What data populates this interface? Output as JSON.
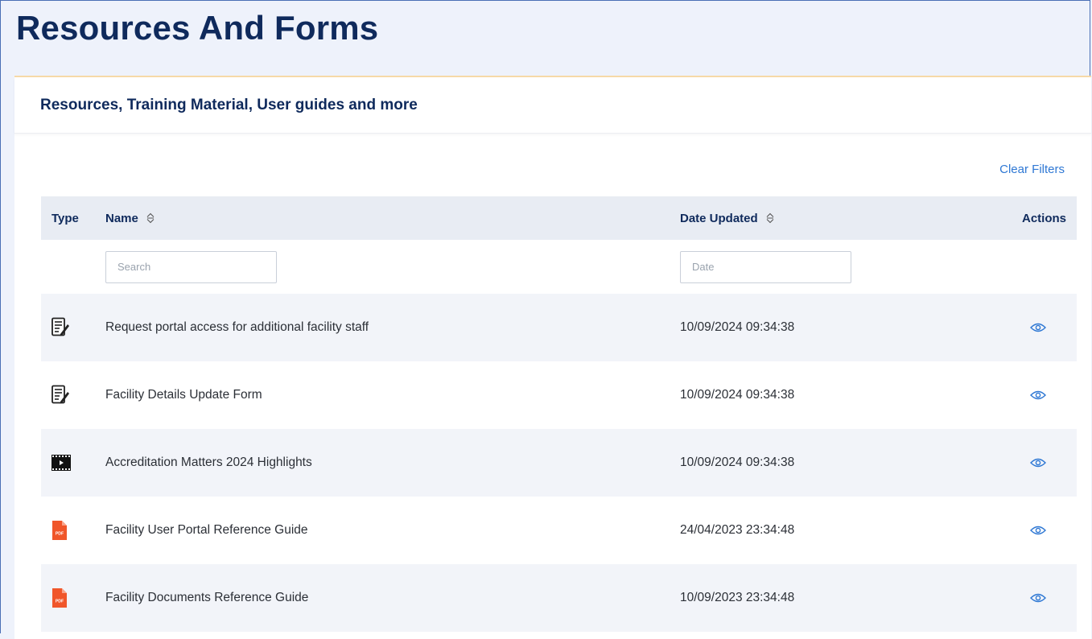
{
  "page": {
    "title": "Resources And Forms"
  },
  "card": {
    "subtitle": "Resources, Training Material, User guides and more",
    "clear_filters": "Clear Filters"
  },
  "table": {
    "columns": {
      "type": "Type",
      "name": "Name",
      "date": "Date Updated",
      "actions": "Actions"
    },
    "filters": {
      "name_placeholder": "Search",
      "date_placeholder": "Date"
    },
    "rows": [
      {
        "type_icon": "form-icon",
        "name": "Request portal access for additional facility staff",
        "date": "10/09/2024 09:34:38",
        "action_icon": "eye-icon"
      },
      {
        "type_icon": "form-icon",
        "name": "Facility Details Update Form",
        "date": "10/09/2024 09:34:38",
        "action_icon": "eye-icon"
      },
      {
        "type_icon": "video-icon",
        "name": "Accreditation Matters 2024 Highlights",
        "date": "10/09/2024 09:34:38",
        "action_icon": "eye-icon"
      },
      {
        "type_icon": "pdf-icon",
        "name": "Facility User Portal Reference Guide",
        "date": "24/04/2023 23:34:48",
        "action_icon": "eye-icon"
      },
      {
        "type_icon": "pdf-icon",
        "name": "Facility Documents Reference Guide",
        "date": "10/09/2023 23:34:48",
        "action_icon": "eye-icon"
      }
    ]
  },
  "colors": {
    "title": "#0f2a5c",
    "link": "#2f78d4",
    "pdf": "#f0562a",
    "header_bg": "#e8ecf3",
    "row_shade": "#f2f4f9"
  }
}
